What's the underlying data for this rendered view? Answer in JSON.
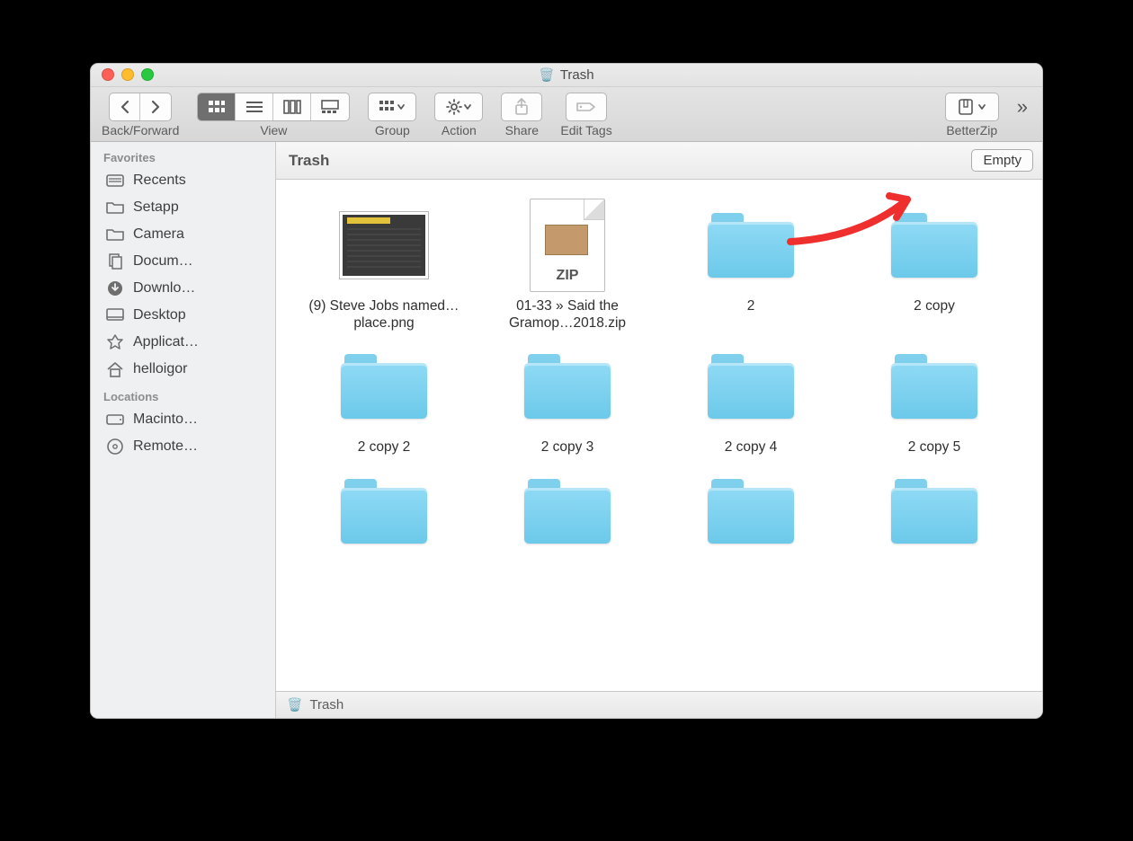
{
  "window": {
    "title": "Trash"
  },
  "toolbar": {
    "back_forward_label": "Back/Forward",
    "view_label": "View",
    "group_label": "Group",
    "action_label": "Action",
    "share_label": "Share",
    "edit_tags_label": "Edit Tags",
    "betterzip_label": "BetterZip"
  },
  "loc_header": {
    "title": "Trash",
    "empty_label": "Empty"
  },
  "sidebar": {
    "sections": [
      {
        "title": "Favorites",
        "items": [
          {
            "icon": "recents",
            "label": "Recents"
          },
          {
            "icon": "folder",
            "label": "Setapp"
          },
          {
            "icon": "folder",
            "label": "Camera"
          },
          {
            "icon": "documents",
            "label": "Docum…"
          },
          {
            "icon": "downloads",
            "label": "Downlo…"
          },
          {
            "icon": "desktop",
            "label": "Desktop"
          },
          {
            "icon": "apps",
            "label": "Applicat…"
          },
          {
            "icon": "home",
            "label": "helloigor"
          }
        ]
      },
      {
        "title": "Locations",
        "items": [
          {
            "icon": "disk",
            "label": "Macinto…"
          },
          {
            "icon": "remote",
            "label": "Remote…"
          }
        ]
      }
    ]
  },
  "items": [
    {
      "kind": "image",
      "label": "(9) Steve Jobs named…place.png"
    },
    {
      "kind": "zip",
      "label": "01-33 » Said the Gramop…2018.zip",
      "badge": "ZIP"
    },
    {
      "kind": "folder",
      "label": "2"
    },
    {
      "kind": "folder",
      "label": "2 copy"
    },
    {
      "kind": "folder",
      "label": "2 copy 2"
    },
    {
      "kind": "folder",
      "label": "2 copy 3"
    },
    {
      "kind": "folder",
      "label": "2 copy 4"
    },
    {
      "kind": "folder",
      "label": "2 copy 5"
    },
    {
      "kind": "folder",
      "label": ""
    },
    {
      "kind": "folder",
      "label": ""
    },
    {
      "kind": "folder",
      "label": ""
    },
    {
      "kind": "folder",
      "label": ""
    }
  ],
  "pathbar": {
    "label": "Trash"
  }
}
